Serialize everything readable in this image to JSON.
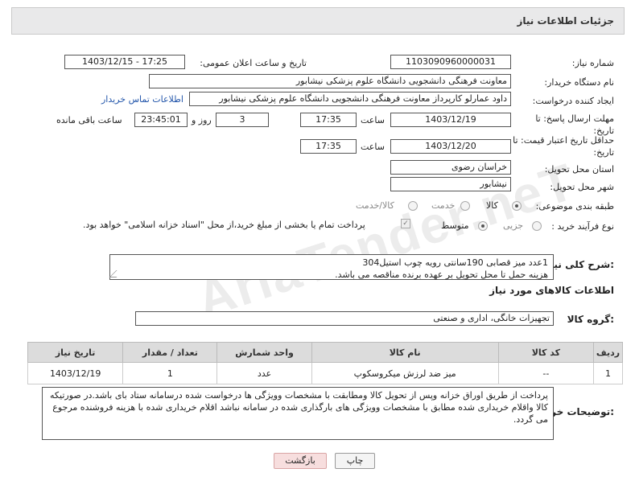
{
  "page_title": "جزئیات اطلاعات نیاز",
  "fields": {
    "need_number_label": "شماره نیاز:",
    "need_number": "1103090960000031",
    "announce_label": "تاریخ و ساعت اعلان عمومی:",
    "announce_value": "1403/12/15 - 17:25",
    "buyer_org_label": "نام دستگاه خریدار:",
    "buyer_org": "معاونت فرهنگی دانشجویی دانشگاه علوم پزشکی نیشابور",
    "creator_label": "ایجاد کننده درخواست:",
    "creator": "داود عمارلو کارپرداز معاونت فرهنگی دانشجویی دانشگاه علوم پزشکی نیشابور",
    "contact_link": "اطلاعات تماس خریدار",
    "deadline_label_1": "مهلت ارسال پاسخ: تا",
    "deadline_label_2": "تاریخ:",
    "deadline_date": "1403/12/19",
    "time_label": "ساعت",
    "deadline_time": "17:35",
    "days_count": "3",
    "days_label": "روز و",
    "remaining_time": "23:45:01",
    "remaining_label": "ساعت باقی مانده",
    "validity_label_1": "حداقل تاریخ اعتبار قیمت: تا",
    "validity_label_2": "تاریخ:",
    "validity_date": "1403/12/20",
    "validity_time": "17:35",
    "province_label": "استان محل تحویل:",
    "province": "خراسان رضوی",
    "city_label": "شهر محل تحویل:",
    "city": "نیشابور",
    "category_label": "طبقه بندی موضوعی:",
    "category_options": [
      "کالا",
      "خدمت",
      "کالا/خدمت"
    ],
    "process_label": "نوع فرآیند خرید :",
    "process_options": [
      "جزیی",
      "متوسط"
    ],
    "payment_note": "پرداخت تمام یا بخشی از مبلغ خرید،از محل \"اسناد خزانه اسلامی\" خواهد بود."
  },
  "description": {
    "label": "شرح کلی نیاز:",
    "line1": "1عدد میز قصابی 190سانتی رویه چوب استیل304",
    "line2": "هزینه حمل تا محل تحویل بر عهده برنده مناقصه می باشد."
  },
  "goods_info_title": "اطلاعات کالاهای مورد نیاز",
  "goods_group": {
    "label": "گروه کالا:",
    "value": "تجهیزات خانگی، اداری و صنعتی"
  },
  "table": {
    "headers": [
      "ردیف",
      "کد کالا",
      "نام کالا",
      "واحد شمارش",
      "تعداد / مقدار",
      "تاریخ نیاز"
    ],
    "rows": [
      [
        "1",
        "--",
        "میز ضد لرزش میکروسکوپ",
        "عدد",
        "1",
        "1403/12/19"
      ]
    ]
  },
  "buyer_notes": {
    "label": "توضیحات خریدار:",
    "text": "پرداخت از طریق اوراق خزانه وپس از تحویل کالا ومطابقت با مشخصات  وویژگی ها درخواست شده درسامانه ستاد بای باشد.در صورتیکه کالا واقلام خریداری شده مطابق با مشخصات وویژگی های بارگذاری شده در سامانه نباشد اقلام خریداری شده با هزینه فروشنده مرجوع می گردد."
  },
  "buttons": {
    "print": "چاپ",
    "back": "بازگشت"
  },
  "watermark": "AriaTender.neT",
  "colors": {
    "header_bg": "#e9e9ea",
    "link": "#2255aa",
    "back_button_bg": "#f7dede",
    "table_header_bg": "#dcdcdc"
  }
}
